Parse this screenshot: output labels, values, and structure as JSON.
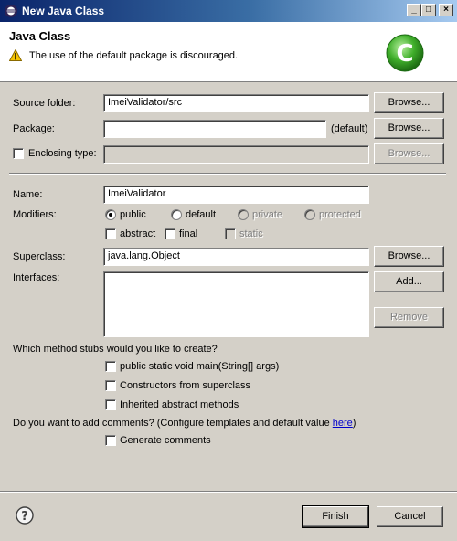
{
  "window": {
    "title": "New Java Class",
    "controls": {
      "minimize": "_",
      "maximize": "□",
      "close": "×"
    }
  },
  "header": {
    "title": "Java Class",
    "message": "The use of the default package is discouraged.",
    "logo_letter": "C",
    "icons": {
      "warning": "warning-icon",
      "logo": "java-class-logo-icon"
    }
  },
  "form": {
    "source_folder": {
      "label": "Source folder:",
      "value": "ImeiValidator/src",
      "button": "Browse..."
    },
    "package": {
      "label": "Package:",
      "value": "",
      "suffix": "(default)",
      "button": "Browse..."
    },
    "enclosing_type": {
      "label": "Enclosing type:",
      "value": "",
      "checked": false,
      "button": "Browse..."
    },
    "name": {
      "label": "Name:",
      "value": "ImeiValidator"
    },
    "modifiers": {
      "label": "Modifiers:",
      "radios": [
        {
          "label": "public",
          "selected": true,
          "enabled": true
        },
        {
          "label": "default",
          "selected": false,
          "enabled": true
        },
        {
          "label": "private",
          "selected": false,
          "enabled": false
        },
        {
          "label": "protected",
          "selected": false,
          "enabled": false
        }
      ],
      "checks": [
        {
          "label": "abstract",
          "checked": false,
          "enabled": true
        },
        {
          "label": "final",
          "checked": false,
          "enabled": true
        },
        {
          "label": "static",
          "checked": false,
          "enabled": false
        }
      ]
    },
    "superclass": {
      "label": "Superclass:",
      "value": "java.lang.Object",
      "button": "Browse..."
    },
    "interfaces": {
      "label": "Interfaces:",
      "add_button": "Add...",
      "remove_button": "Remove",
      "items": []
    },
    "stubs": {
      "question": "Which method stubs would you like to create?",
      "options": [
        {
          "label": "public static void main(String[] args)",
          "checked": false
        },
        {
          "label": "Constructors from superclass",
          "checked": false
        },
        {
          "label": "Inherited abstract methods",
          "checked": false
        }
      ]
    },
    "comments": {
      "question_prefix": "Do you want to add comments? (Configure templates and default value ",
      "link": "here",
      "question_suffix": ")",
      "option": {
        "label": "Generate comments",
        "checked": false
      }
    }
  },
  "footer": {
    "finish": "Finish",
    "cancel": "Cancel",
    "help_glyph": "?"
  },
  "colors": {
    "title_start": "#0a246a",
    "title_end": "#a6caf0",
    "dialog_bg": "#d4d0c8",
    "logo_green": "#3fae2a",
    "link": "#0000cc"
  }
}
